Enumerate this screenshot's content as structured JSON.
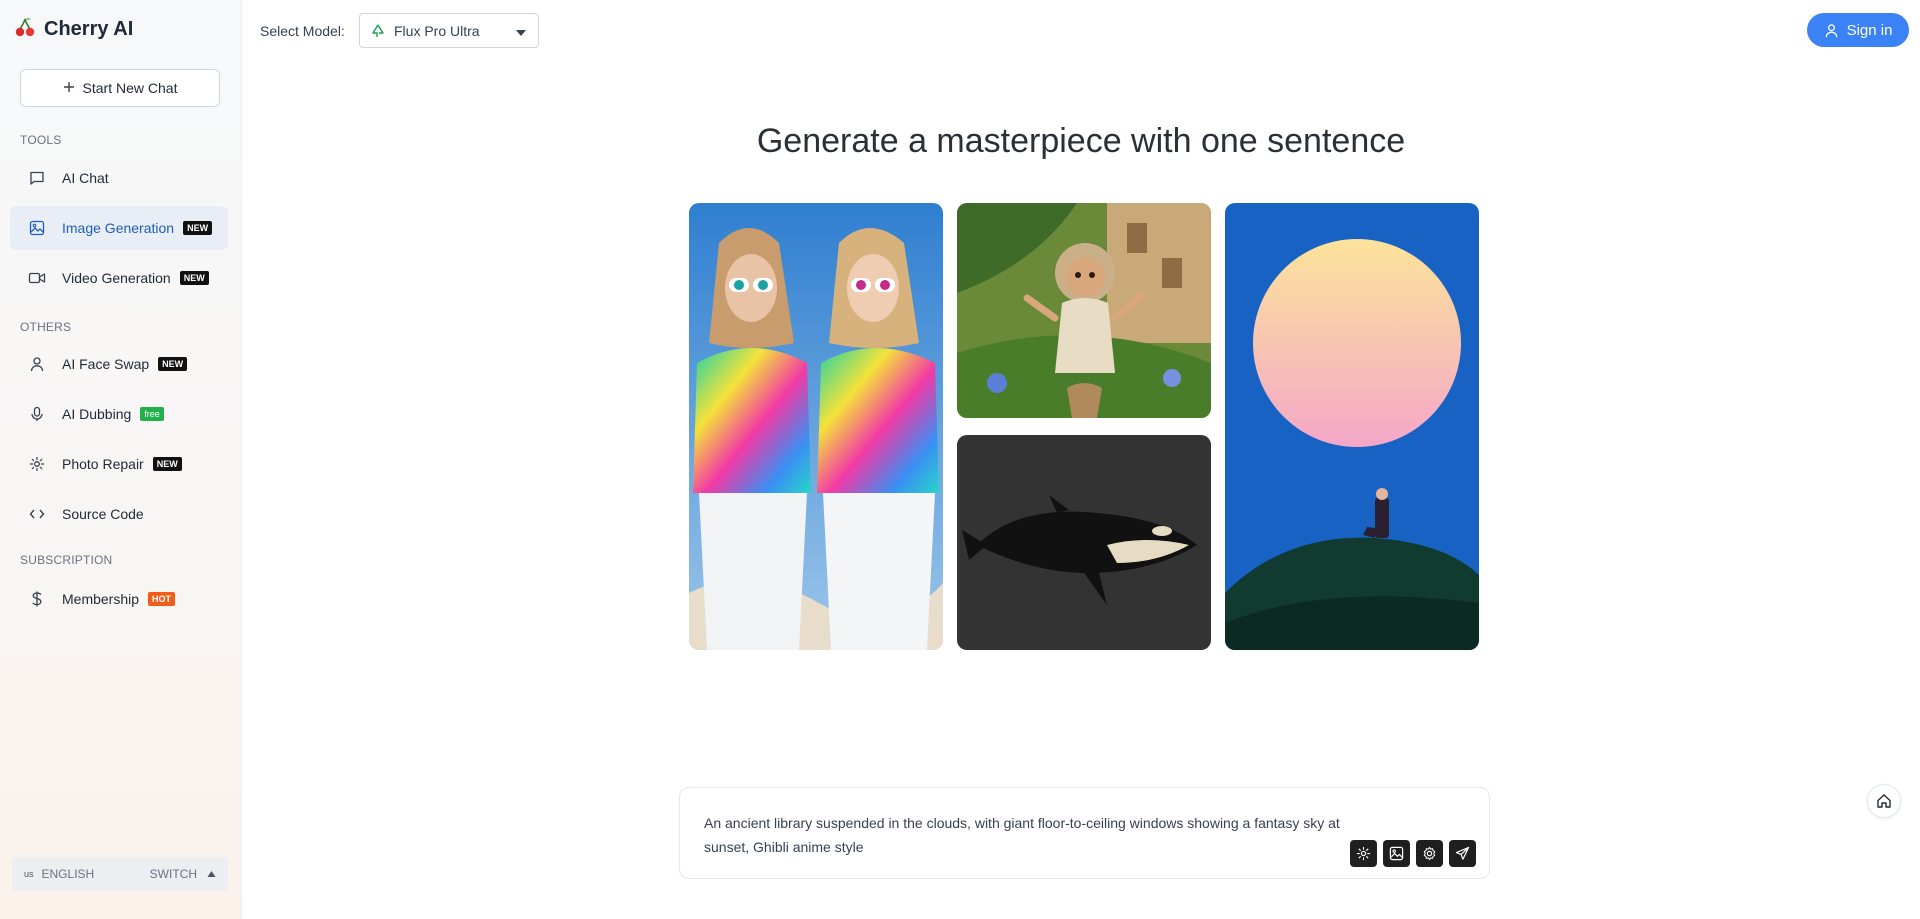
{
  "brand": {
    "name": "Cherry AI",
    "logo": "cherry-icon"
  },
  "sidebar": {
    "new_chat_label": "Start New Chat",
    "sections": {
      "tools": "TOOLS",
      "others": "OTHERS",
      "subscription": "SUBSCRIPTION"
    },
    "items": [
      {
        "label": "AI Chat",
        "icon": "chat-icon"
      },
      {
        "label": "Image Generation",
        "icon": "image-icon",
        "badge": "NEW",
        "active": true
      },
      {
        "label": "Video Generation",
        "icon": "video-icon",
        "badge": "NEW"
      },
      {
        "label": "AI Face Swap",
        "icon": "user-icon",
        "badge": "NEW"
      },
      {
        "label": "AI Dubbing",
        "icon": "microphone-icon",
        "badge": "free"
      },
      {
        "label": "Photo Repair",
        "icon": "sparkle-icon",
        "badge": "NEW"
      },
      {
        "label": "Source Code",
        "icon": "code-icon"
      },
      {
        "label": "Membership",
        "icon": "dollar-icon",
        "badge": "HOT"
      }
    ],
    "language": {
      "flag": "us",
      "label": "ENGLISH",
      "switch_label": "SWITCH"
    }
  },
  "header": {
    "select_model_label": "Select Model:",
    "model_value": "Flux Pro Ultra",
    "sign_in_label": "Sign in"
  },
  "main": {
    "headline": "Generate a masterpiece with one sentence",
    "prompt_text": "An ancient library suspended in the clouds, with giant floor-to-ceiling windows showing a fantasy sky at sunset, Ghibli anime style"
  },
  "colors": {
    "accent": "#3b82f6",
    "active_nav_bg": "#e9eef6",
    "active_nav_text": "#1e5fb8",
    "badge_new": "#111111",
    "badge_free": "#22b04b",
    "badge_hot": "#f25c1a"
  }
}
